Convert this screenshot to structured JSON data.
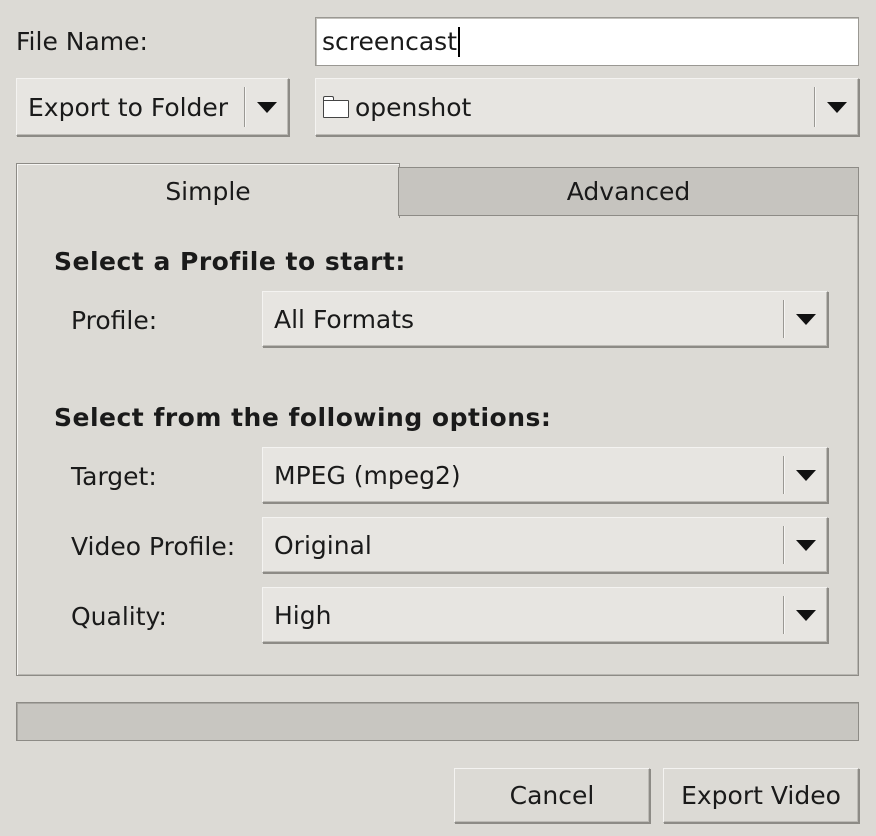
{
  "file_name": {
    "label": "File Name:",
    "value": "screencast"
  },
  "export_mode": {
    "selected": "Export to Folder"
  },
  "folder": {
    "icon": "folder-icon",
    "selected": "openshot"
  },
  "tabs": [
    {
      "label": "Simple",
      "active": true
    },
    {
      "label": "Advanced",
      "active": false
    }
  ],
  "simple": {
    "profile_heading": "Select a Profile to start:",
    "profile": {
      "label": "Profile:",
      "selected": "All Formats"
    },
    "options_heading": "Select from the following options:",
    "target": {
      "label": "Target:",
      "selected": "MPEG (mpeg2)"
    },
    "video_profile": {
      "label": "Video Profile:",
      "selected": "Original"
    },
    "quality": {
      "label": "Quality:",
      "selected": "High"
    }
  },
  "progress": {
    "fraction": 0
  },
  "buttons": {
    "cancel": "Cancel",
    "export": "Export Video"
  }
}
